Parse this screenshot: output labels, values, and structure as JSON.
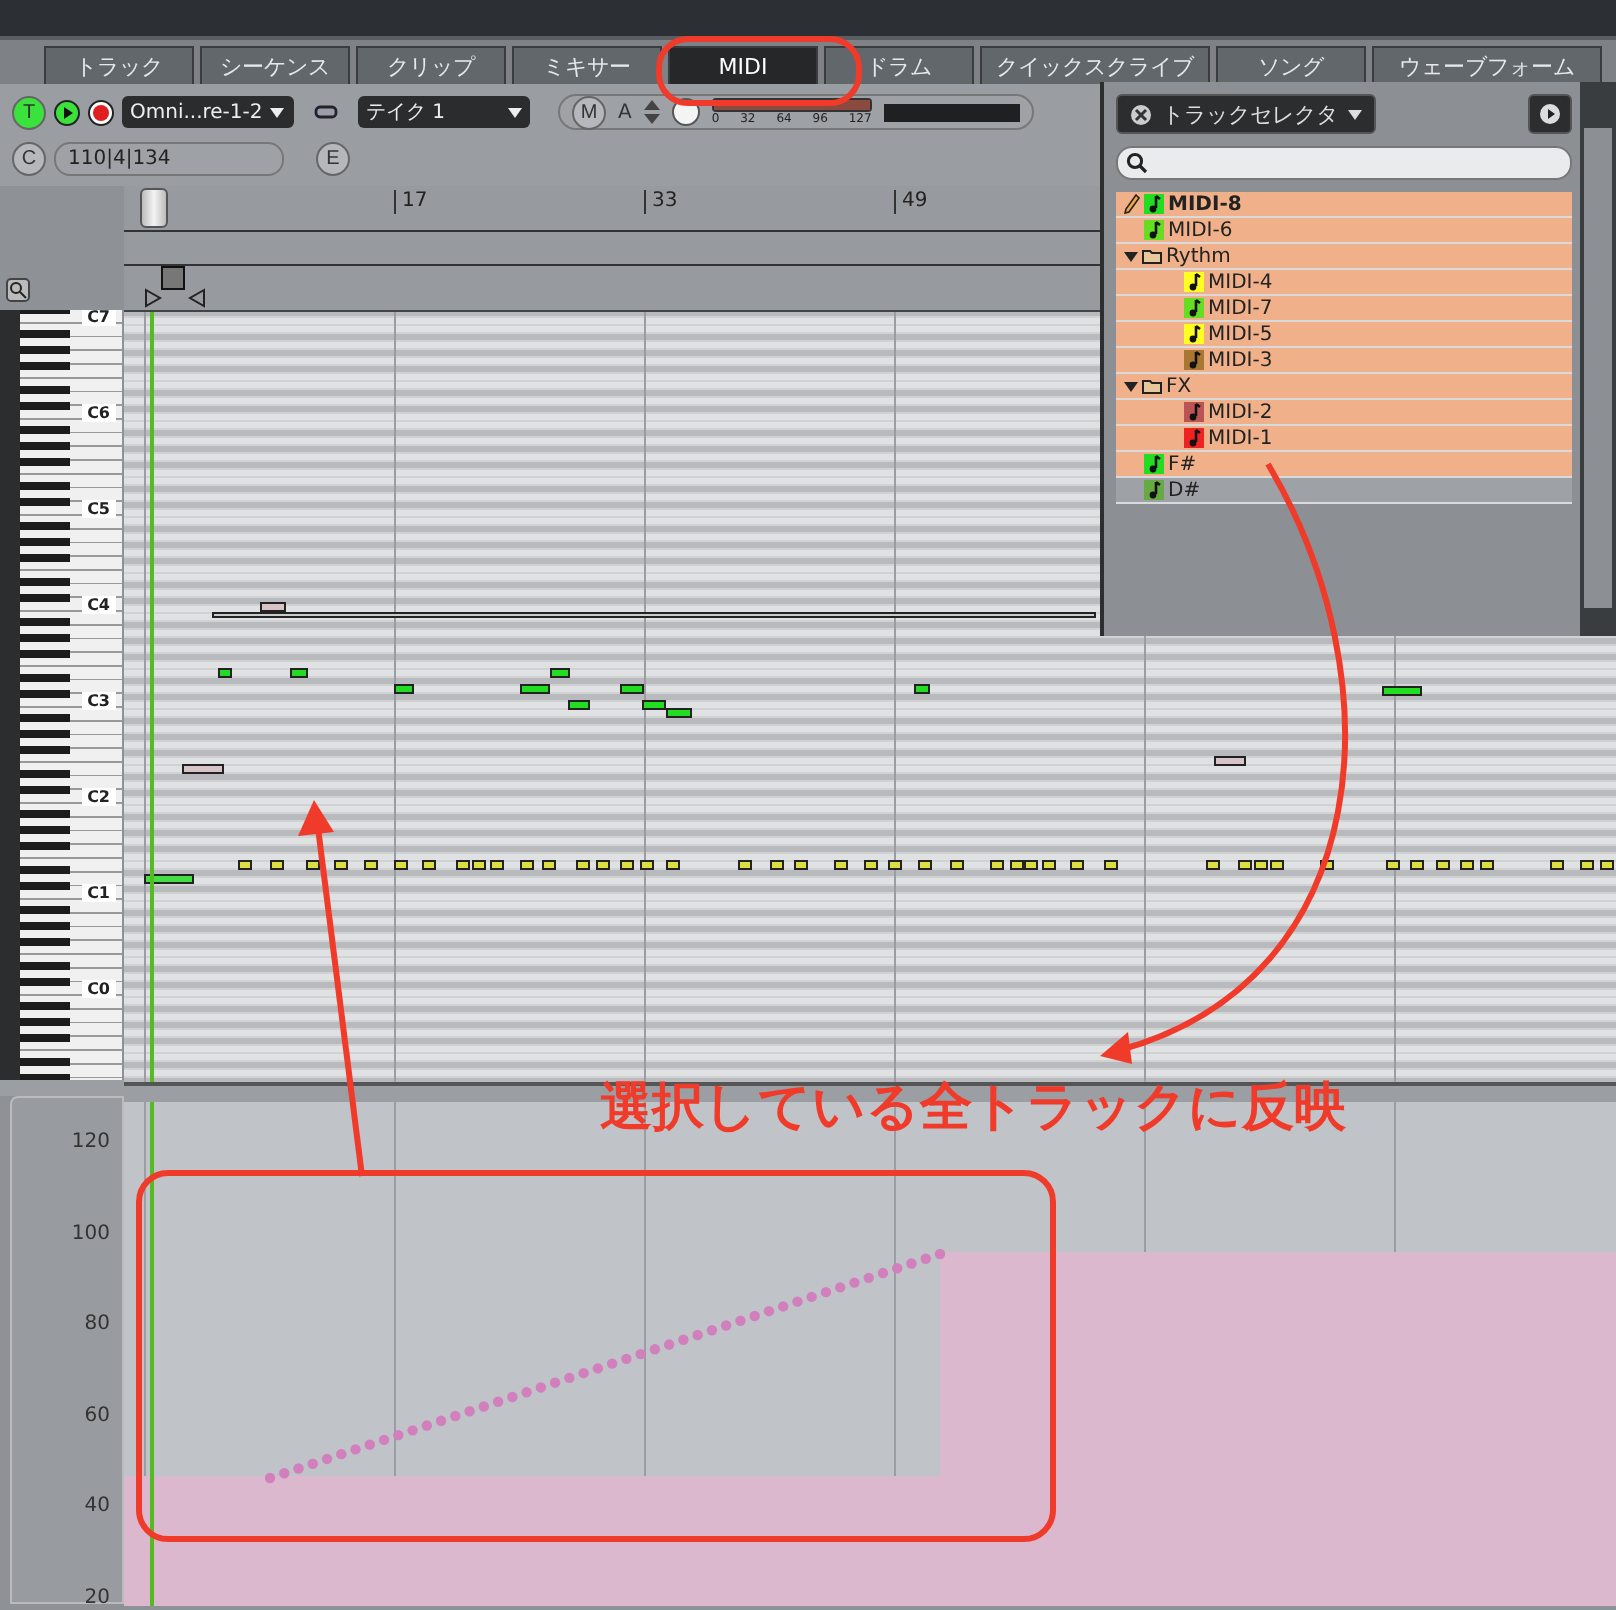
{
  "tabs": [
    {
      "label": "トラック",
      "selected": false
    },
    {
      "label": "シーケンス",
      "selected": false
    },
    {
      "label": "クリップ",
      "selected": false
    },
    {
      "label": "ミキサー",
      "selected": false
    },
    {
      "label": "MIDI",
      "selected": true
    },
    {
      "label": "ドラム",
      "selected": false
    },
    {
      "label": "クイックスクライブ",
      "selected": false
    },
    {
      "label": "ソング",
      "selected": false
    },
    {
      "label": "ウェーブフォーム",
      "selected": false
    }
  ],
  "toolbar": {
    "track_button": "T",
    "input_dropdown": "Omni...re-1-2",
    "take_dropdown": "テイク 1",
    "mute_button": "M",
    "automation_button": "A",
    "velocity_scale": [
      "0",
      "32",
      "64",
      "96",
      "127"
    ],
    "velocity_slider": {
      "level": 1
    },
    "position_button": "C",
    "position": "110|4|134",
    "edit_button": "E"
  },
  "ruler": {
    "marks": [
      "17",
      "33",
      "49"
    ]
  },
  "keyboard": {
    "octave_labels": [
      "C7",
      "C6",
      "C5",
      "C4",
      "C3",
      "C2",
      "C1",
      "C0"
    ]
  },
  "velocity_lane": {
    "axis_labels": [
      "120",
      "100",
      "80",
      "60",
      "40",
      "20"
    ]
  },
  "track_selector": {
    "title": "トラックセレクタ",
    "tracks": [
      {
        "kind": "track",
        "name": "MIDI-8",
        "selected": true,
        "editing": true,
        "color": "#22dd22"
      },
      {
        "kind": "track",
        "name": "MIDI-6",
        "selected": true,
        "editing": false,
        "color": "#66dd22"
      },
      {
        "kind": "folder",
        "name": "Rythm",
        "selected": true,
        "expanded": true,
        "children": [
          {
            "kind": "track",
            "name": "MIDI-4",
            "selected": true,
            "editing": false,
            "color": "#ffff22"
          },
          {
            "kind": "track",
            "name": "MIDI-7",
            "selected": true,
            "editing": false,
            "color": "#66dd22"
          },
          {
            "kind": "track",
            "name": "MIDI-5",
            "selected": true,
            "editing": false,
            "color": "#ffff22"
          },
          {
            "kind": "track",
            "name": "MIDI-3",
            "selected": true,
            "editing": false,
            "color": "#aa7733"
          }
        ]
      },
      {
        "kind": "folder",
        "name": "FX",
        "selected": true,
        "expanded": true,
        "children": [
          {
            "kind": "track",
            "name": "MIDI-2",
            "selected": true,
            "editing": false,
            "color": "#bb5555"
          },
          {
            "kind": "track",
            "name": "MIDI-1",
            "selected": true,
            "editing": false,
            "color": "#ee2222"
          }
        ]
      },
      {
        "kind": "track",
        "name": "F#",
        "selected": true,
        "editing": false,
        "color": "#22dd22"
      },
      {
        "kind": "track",
        "name": "D#",
        "selected": false,
        "editing": false,
        "color": "#66aa44"
      }
    ]
  },
  "annotation": {
    "callout": "選択している全トラックに反映"
  }
}
